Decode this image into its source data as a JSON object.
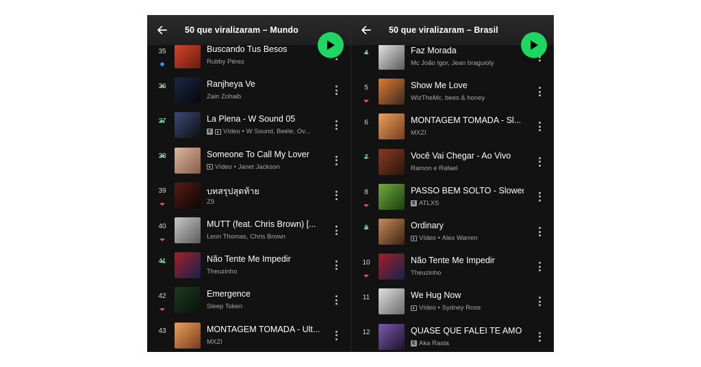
{
  "panels": [
    {
      "title": "50 que viralizaram – Mundo",
      "rows": [
        {
          "rank": "35",
          "trend": "new",
          "title": "Buscando Tus Besos",
          "badges": [],
          "artists": "Rubby Pérez",
          "art": [
            "#d8472b",
            "#6b1a12"
          ]
        },
        {
          "rank": "36",
          "trend": "up",
          "title": "Ranjheya Ve",
          "badges": [],
          "artists": "Zain Zohaib",
          "art": [
            "#1c2742",
            "#06080f"
          ]
        },
        {
          "rank": "37",
          "trend": "up",
          "title": "La Plena - W Sound 05",
          "badges": [
            "E",
            "video"
          ],
          "video_label": "Vídeo",
          "artists": "W Sound, Beéle, Ov...",
          "art": [
            "#3b4a7a",
            "#0e0e0e"
          ]
        },
        {
          "rank": "38",
          "trend": "up",
          "title": "Someone To Call My Lover",
          "badges": [
            "video"
          ],
          "video_label": "Vídeo",
          "artists": "Janet Jackson",
          "art": [
            "#d9b8a2",
            "#8a5a48"
          ]
        },
        {
          "rank": "39",
          "trend": "down",
          "title": "บทสรุปสุดท้าย",
          "badges": [],
          "artists": "Z9",
          "art": [
            "#5a1b14",
            "#0c0605"
          ]
        },
        {
          "rank": "40",
          "trend": "down",
          "title": "MUTT (feat. Chris Brown) [...",
          "badges": [],
          "artists": "Leon Thomas, Chris Brown",
          "art": [
            "#c9c9c9",
            "#5b5b5b"
          ]
        },
        {
          "rank": "41",
          "trend": "up",
          "title": "Não Tente Me Impedir",
          "badges": [],
          "artists": "Theuzinho",
          "art": [
            "#a51e2a",
            "#15234a"
          ]
        },
        {
          "rank": "42",
          "trend": "down",
          "title": "Emergence",
          "badges": [],
          "artists": "Sleep Token",
          "art": [
            "#1f3a22",
            "#081208"
          ]
        },
        {
          "rank": "43",
          "trend": "none",
          "title": "MONTAGEM TOMADA - Ult...",
          "badges": [],
          "artists": "MXZI",
          "art": [
            "#e8a25a",
            "#7a3a1e"
          ]
        }
      ]
    },
    {
      "title": "50 que viralizaram – Brasil",
      "rows": [
        {
          "rank": "4",
          "trend": "up",
          "title": "Faz Morada",
          "badges": [],
          "artists": "Mc João Igor, Jean braguioly",
          "art": [
            "#e6e6e6",
            "#5a5a5a"
          ]
        },
        {
          "rank": "5",
          "trend": "down",
          "title": "Show Me Love",
          "badges": [],
          "artists": "WizTheMc, bees & honey",
          "art": [
            "#e07a2e",
            "#3a2a20"
          ]
        },
        {
          "rank": "6",
          "trend": "none",
          "title": "MONTAGEM TOMADA - Sl...",
          "badges": [],
          "artists": "MXZI",
          "art": [
            "#e8a25a",
            "#7a3a1e"
          ]
        },
        {
          "rank": "7",
          "trend": "up",
          "title": "Você Vai Chegar - Ao Vivo",
          "badges": [],
          "artists": "Ramon e Rafael",
          "art": [
            "#8b3a22",
            "#2a150c"
          ]
        },
        {
          "rank": "8",
          "trend": "down",
          "title": "PASSO BEM SOLTO - Slowed",
          "badges": [
            "E"
          ],
          "artists": "ATLXS",
          "art": [
            "#6fae3a",
            "#1f3a12"
          ]
        },
        {
          "rank": "9",
          "trend": "up",
          "title": "Ordinary",
          "badges": [
            "video"
          ],
          "video_label": "Vídeo",
          "artists": "Alex Warren",
          "art": [
            "#c98a5a",
            "#3a2212"
          ]
        },
        {
          "rank": "10",
          "trend": "down",
          "title": "Não Tente Me Impedir",
          "badges": [],
          "artists": "Theuzinho",
          "art": [
            "#a51e2a",
            "#15234a"
          ]
        },
        {
          "rank": "11",
          "trend": "none",
          "title": "We Hug Now",
          "badges": [
            "video"
          ],
          "video_label": "Vídeo",
          "artists": "Sydney Rose",
          "art": [
            "#e0e0e0",
            "#6a6a6a"
          ]
        },
        {
          "rank": "12",
          "trend": "none",
          "title": "QUASE QUE FALEI TE AMO",
          "badges": [
            "E"
          ],
          "artists": "Aka Rasta",
          "art": [
            "#7a5aa8",
            "#1c1230"
          ]
        }
      ]
    }
  ],
  "colors": {
    "accent": "#1ed760",
    "up": "#1ed760",
    "down": "#e9535b",
    "new": "#3d91f4"
  }
}
